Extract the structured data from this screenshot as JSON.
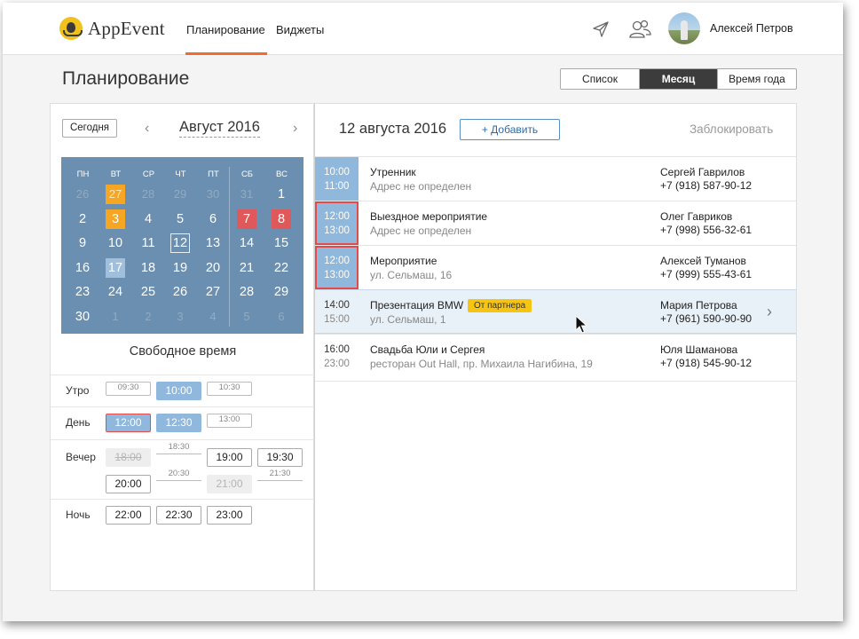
{
  "app": {
    "logo_text": "AppEvent",
    "nav": [
      "Планирование",
      "Виджеты"
    ],
    "user_name": "Алексей Петров",
    "accent_color": "#f26b2a"
  },
  "page": {
    "title": "Планирование",
    "views": [
      "Список",
      "Месяц",
      "Время года"
    ],
    "active_view": "Месяц"
  },
  "calendar": {
    "today_button": "Сегодня",
    "prev_icon": "chevron-left-icon",
    "next_icon": "chevron-right-icon",
    "month_label": "Август 2016",
    "weekdays": [
      "ПН",
      "ВТ",
      "СР",
      "ЧТ",
      "ПТ",
      "СБ",
      "ВС"
    ],
    "weeks": [
      [
        {
          "d": "26",
          "m": true
        },
        {
          "d": "27",
          "m": true,
          "s": "orange"
        },
        {
          "d": "28",
          "m": true
        },
        {
          "d": "29",
          "m": true
        },
        {
          "d": "30",
          "m": true
        },
        {
          "d": "31",
          "m": true
        },
        {
          "d": "1"
        }
      ],
      [
        {
          "d": "2"
        },
        {
          "d": "3",
          "s": "orange"
        },
        {
          "d": "4"
        },
        {
          "d": "5"
        },
        {
          "d": "6"
        },
        {
          "d": "7",
          "s": "red"
        },
        {
          "d": "8",
          "s": "red"
        }
      ],
      [
        {
          "d": "9"
        },
        {
          "d": "10"
        },
        {
          "d": "11"
        },
        {
          "d": "12",
          "s": "today"
        },
        {
          "d": "13"
        },
        {
          "d": "14"
        },
        {
          "d": "15"
        }
      ],
      [
        {
          "d": "16"
        },
        {
          "d": "17",
          "s": "light"
        },
        {
          "d": "18"
        },
        {
          "d": "19"
        },
        {
          "d": "20"
        },
        {
          "d": "21"
        },
        {
          "d": "22"
        }
      ],
      [
        {
          "d": "23"
        },
        {
          "d": "24"
        },
        {
          "d": "25"
        },
        {
          "d": "26"
        },
        {
          "d": "27"
        },
        {
          "d": "28"
        },
        {
          "d": "29"
        }
      ],
      [
        {
          "d": "30"
        },
        {
          "d": "1",
          "m": true
        },
        {
          "d": "2",
          "m": true
        },
        {
          "d": "3",
          "m": true
        },
        {
          "d": "4",
          "m": true
        },
        {
          "d": "5",
          "m": true
        },
        {
          "d": "6",
          "m": true
        }
      ]
    ]
  },
  "free_time": {
    "title": "Свободное время",
    "rows": [
      {
        "label": "Утро",
        "slots": [
          "09:30",
          "10:00",
          "10:30"
        ]
      },
      {
        "label": "День",
        "slots": [
          "12:00",
          "12:30",
          "13:00"
        ]
      },
      {
        "label": "Вечер",
        "slots": [
          "18:00",
          "18:30",
          "19:00",
          "19:30",
          "20:00",
          "20:30",
          "21:00",
          "21:30"
        ]
      },
      {
        "label": "Ночь",
        "slots": [
          "22:00",
          "22:30",
          "23:00"
        ]
      }
    ]
  },
  "schedule": {
    "date_title": "12 августа 2016",
    "add_button": "+ Добавить",
    "block_link": "Заблокировать",
    "events": [
      {
        "start": "10:00",
        "end": "11:00",
        "title": "Утренник",
        "place": "Адрес не определен",
        "person": "Сергей Гаврилов",
        "phone": "+7 (918) 587-90-12"
      },
      {
        "start": "12:00",
        "end": "13:00",
        "title": "Выездное мероприятие",
        "place": "Адрес не определен",
        "person": "Олег Гавриков",
        "phone": "+7 (998) 556-32-61"
      },
      {
        "start": "12:00",
        "end": "13:00",
        "title": "Мероприятие",
        "place": "ул. Сельмаш, 16",
        "person": "Алексей Туманов",
        "phone": "+7 (999) 555-43-61"
      },
      {
        "start": "14:00",
        "end": "15:00",
        "title": "Презентация BMW",
        "badge": "От партнера",
        "place": "ул. Сельмаш, 1",
        "person": "Мария Петрова",
        "phone": "+7 (961) 590-90-90"
      },
      {
        "start": "16:00",
        "end": "23:00",
        "title": "Свадьба Юли и Сергея",
        "place": "ресторан Out Hall, пр. Михаила Нагибина, 19",
        "person": "Юля Шаманова",
        "phone": "+7 (918) 545-90-12"
      }
    ]
  }
}
